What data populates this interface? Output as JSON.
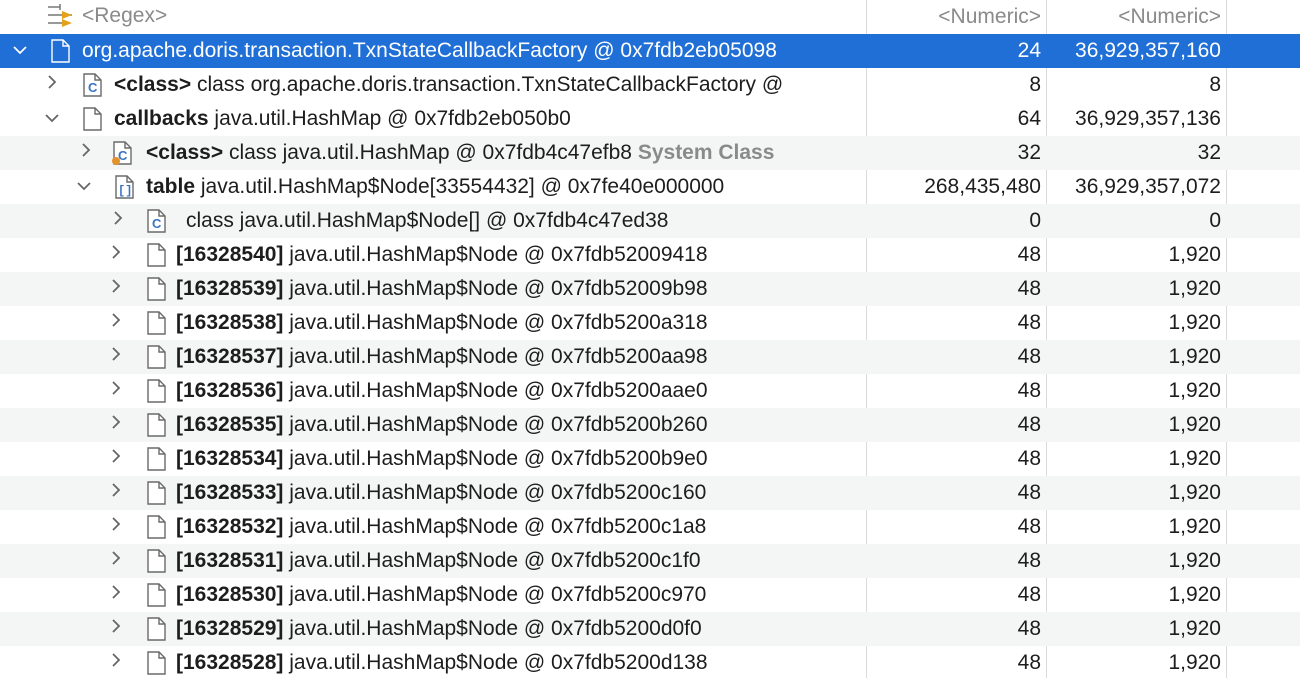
{
  "header": {
    "filter": "<Regex>",
    "shallow": "<Numeric>",
    "retained": "<Numeric>"
  },
  "rows": [
    {
      "name": "",
      "text": "org.apache.doris.transaction.TxnStateCallbackFactory @ 0x7fdb2eb05098",
      "shallow": "24",
      "retained": "36,929,357,160"
    },
    {
      "name": "<class>",
      "text": "class org.apache.doris.transaction.TxnStateCallbackFactory @",
      "shallow": "8",
      "retained": "8"
    },
    {
      "name": "callbacks",
      "text": "java.util.HashMap @ 0x7fdb2eb050b0",
      "shallow": "64",
      "retained": "36,929,357,136"
    },
    {
      "name": "<class>",
      "text": "class java.util.HashMap @ 0x7fdb4c47efb8",
      "extra": "System Class",
      "shallow": "32",
      "retained": "32"
    },
    {
      "name": "table",
      "text": "java.util.HashMap$Node[33554432] @ 0x7fe40e000000",
      "shallow": "268,435,480",
      "retained": "36,929,357,072"
    },
    {
      "name": "",
      "text": "class java.util.HashMap$Node[] @ 0x7fdb4c47ed38",
      "shallow": "0",
      "retained": "0"
    },
    {
      "name": "[16328540]",
      "text": "java.util.HashMap$Node @ 0x7fdb52009418",
      "shallow": "48",
      "retained": "1,920"
    },
    {
      "name": "[16328539]",
      "text": "java.util.HashMap$Node @ 0x7fdb52009b98",
      "shallow": "48",
      "retained": "1,920"
    },
    {
      "name": "[16328538]",
      "text": "java.util.HashMap$Node @ 0x7fdb5200a318",
      "shallow": "48",
      "retained": "1,920"
    },
    {
      "name": "[16328537]",
      "text": "java.util.HashMap$Node @ 0x7fdb5200aa98",
      "shallow": "48",
      "retained": "1,920"
    },
    {
      "name": "[16328536]",
      "text": "java.util.HashMap$Node @ 0x7fdb5200aae0",
      "shallow": "48",
      "retained": "1,920"
    },
    {
      "name": "[16328535]",
      "text": "java.util.HashMap$Node @ 0x7fdb5200b260",
      "shallow": "48",
      "retained": "1,920"
    },
    {
      "name": "[16328534]",
      "text": "java.util.HashMap$Node @ 0x7fdb5200b9e0",
      "shallow": "48",
      "retained": "1,920"
    },
    {
      "name": "[16328533]",
      "text": "java.util.HashMap$Node @ 0x7fdb5200c160",
      "shallow": "48",
      "retained": "1,920"
    },
    {
      "name": "[16328532]",
      "text": "java.util.HashMap$Node @ 0x7fdb5200c1a8",
      "shallow": "48",
      "retained": "1,920"
    },
    {
      "name": "[16328531]",
      "text": "java.util.HashMap$Node @ 0x7fdb5200c1f0",
      "shallow": "48",
      "retained": "1,920"
    },
    {
      "name": "[16328530]",
      "text": "java.util.HashMap$Node @ 0x7fdb5200c970",
      "shallow": "48",
      "retained": "1,920"
    },
    {
      "name": "[16328529]",
      "text": "java.util.HashMap$Node @ 0x7fdb5200d0f0",
      "shallow": "48",
      "retained": "1,920"
    },
    {
      "name": "[16328528]",
      "text": "java.util.HashMap$Node @ 0x7fdb5200d138",
      "shallow": "48",
      "retained": "1,920"
    }
  ],
  "colors": {
    "selection": "#1f6fd6",
    "alt_row": "#f4f5f5",
    "grid": "#dadada"
  }
}
